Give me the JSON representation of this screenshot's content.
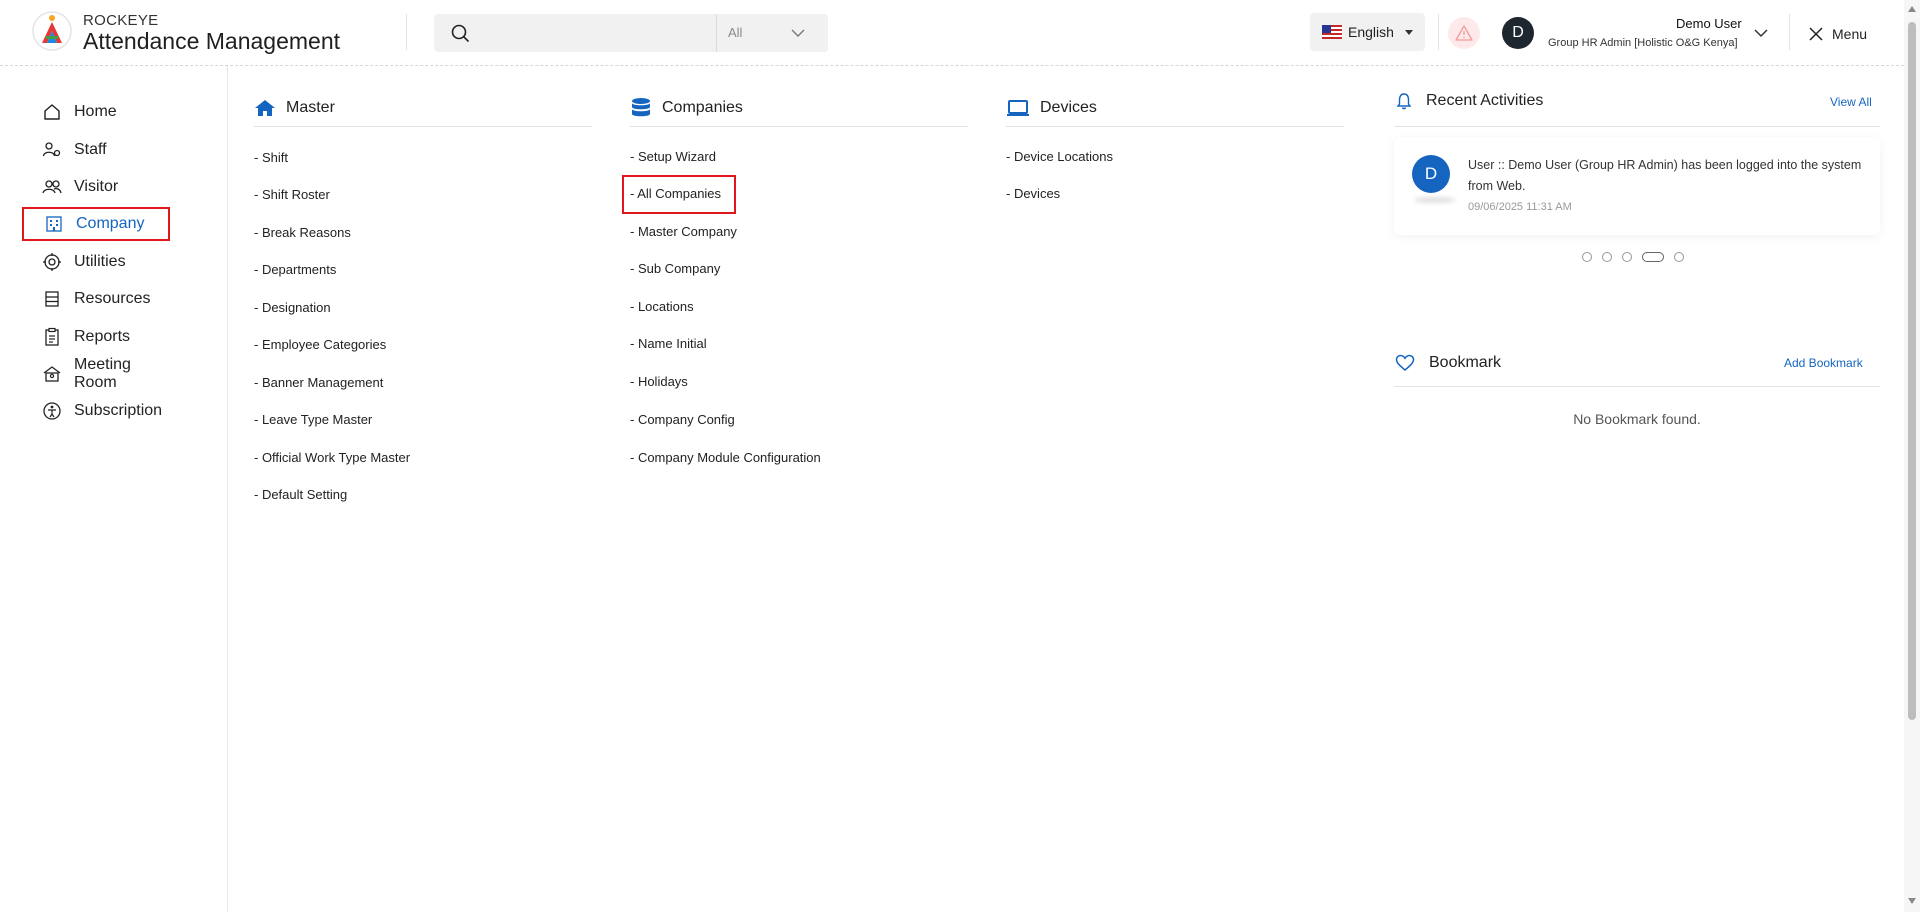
{
  "header": {
    "brand_small": "ROCKEYE",
    "brand_big": "Attendance Management",
    "search_value": "",
    "search_scope": "All",
    "language": "English",
    "avatar_letter": "D",
    "user_name": "Demo User",
    "user_role": "Group HR Admin [Holistic O&G Kenya]",
    "menu_label": "Menu"
  },
  "sidebar": {
    "items": [
      {
        "label": "Home",
        "icon": "home-icon"
      },
      {
        "label": "Staff",
        "icon": "staff-icon"
      },
      {
        "label": "Visitor",
        "icon": "visitor-icon"
      },
      {
        "label": "Company",
        "icon": "company-icon",
        "active": true
      },
      {
        "label": "Utilities",
        "icon": "utilities-icon"
      },
      {
        "label": "Resources",
        "icon": "resources-icon"
      },
      {
        "label": "Reports",
        "icon": "reports-icon"
      },
      {
        "label": "Meeting Room",
        "icon": "meeting-room-icon"
      },
      {
        "label": "Subscription",
        "icon": "subscription-icon"
      }
    ]
  },
  "master": {
    "title": "Master",
    "items": [
      "- Shift",
      "- Shift Roster",
      "- Break Reasons",
      "- Departments",
      "- Designation",
      "- Employee Categories",
      "- Banner Management",
      "- Leave Type Master",
      "- Official Work Type Master",
      "- Default Setting"
    ]
  },
  "companies": {
    "title": "Companies",
    "items": [
      "- Setup Wizard",
      "- All Companies",
      "- Master Company",
      "- Sub Company",
      "- Locations",
      "- Name Initial",
      "- Holidays",
      "- Company Config",
      "- Company Module Configuration"
    ]
  },
  "devices": {
    "title": "Devices",
    "items": [
      "- Device Locations",
      "- Devices"
    ]
  },
  "recent": {
    "title": "Recent Activities",
    "view_all": "View All",
    "avatar_letter": "D",
    "text": "User :: Demo User (Group HR Admin) has been logged into the system from Web.",
    "time": "09/06/2025 11:31 AM"
  },
  "bookmark": {
    "title": "Bookmark",
    "add_label": "Add Bookmark",
    "empty": "No Bookmark found."
  },
  "colors": {
    "accent": "#1565c0",
    "highlight": "#e0161b"
  }
}
